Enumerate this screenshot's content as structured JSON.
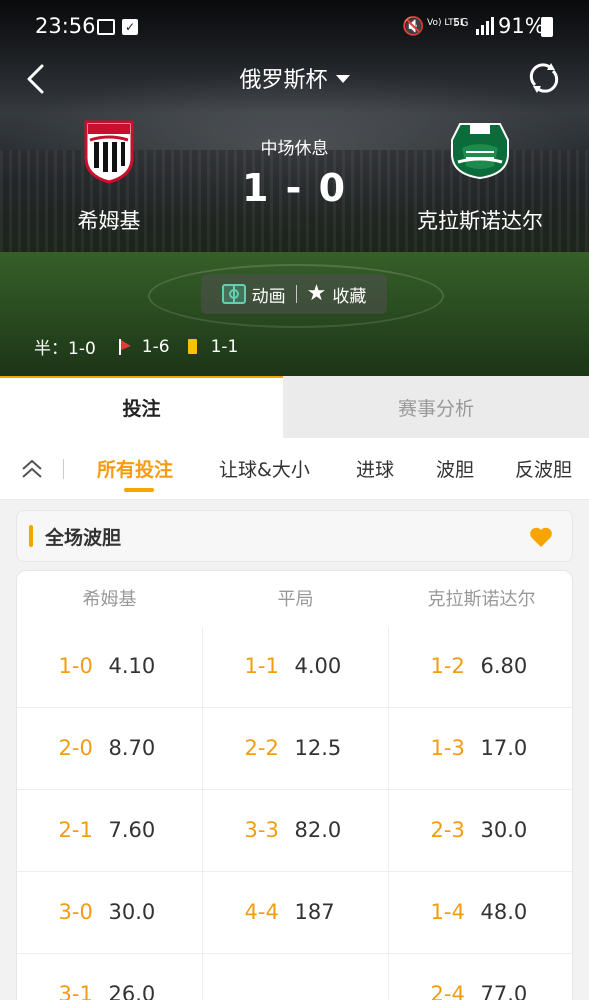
{
  "status_bar": {
    "time": "23:56",
    "battery": "91%",
    "volte": "Vo) LTE1",
    "network": "5G"
  },
  "header": {
    "league": "俄罗斯杯"
  },
  "match": {
    "status": "中场休息",
    "score": "1 - 0",
    "home": {
      "name": "希姆基"
    },
    "away": {
      "name": "克拉斯诺达尔"
    }
  },
  "actions": {
    "animation": "动画",
    "favorite": "收藏"
  },
  "stats": {
    "half": "半：1-0",
    "corners": "1-6",
    "yellow_cards": "1-1"
  },
  "main_tabs": [
    {
      "label": "投注",
      "active": true
    },
    {
      "label": "赛事分析",
      "active": false
    }
  ],
  "sub_tabs": [
    {
      "label": "所有投注",
      "active": true
    },
    {
      "label": "让球&大小"
    },
    {
      "label": "进球"
    },
    {
      "label": "波胆"
    },
    {
      "label": "反波胆"
    }
  ],
  "section": {
    "title": "全场波胆"
  },
  "odds": {
    "columns": [
      "希姆基",
      "平局",
      "克拉斯诺达尔"
    ],
    "rows": [
      [
        {
          "score": "1-0",
          "odds": "4.10"
        },
        {
          "score": "1-1",
          "odds": "4.00"
        },
        {
          "score": "1-2",
          "odds": "6.80"
        }
      ],
      [
        {
          "score": "2-0",
          "odds": "8.70"
        },
        {
          "score": "2-2",
          "odds": "12.5"
        },
        {
          "score": "1-3",
          "odds": "17.0"
        }
      ],
      [
        {
          "score": "2-1",
          "odds": "7.60"
        },
        {
          "score": "3-3",
          "odds": "82.0"
        },
        {
          "score": "2-3",
          "odds": "30.0"
        }
      ],
      [
        {
          "score": "3-0",
          "odds": "30.0"
        },
        {
          "score": "4-4",
          "odds": "187"
        },
        {
          "score": "1-4",
          "odds": "48.0"
        }
      ],
      [
        {
          "score": "3-1",
          "odds": "26.0"
        },
        {
          "score": "",
          "odds": ""
        },
        {
          "score": "2-4",
          "odds": "77.0"
        }
      ]
    ]
  },
  "colors": {
    "accent": "#f7a400",
    "score_text": "#f39c12"
  }
}
